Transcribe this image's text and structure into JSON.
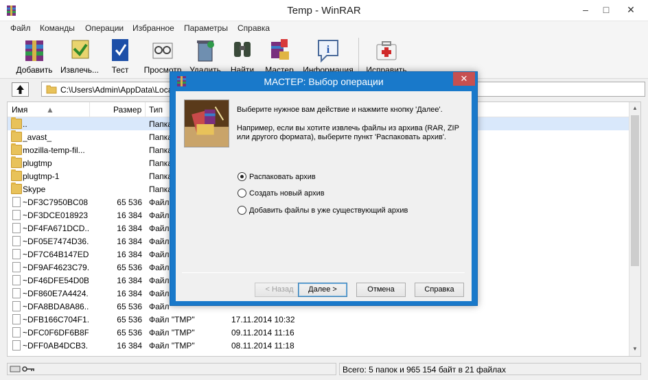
{
  "window": {
    "title": "Temp - WinRAR",
    "min_glyph": "–",
    "max_glyph": "□",
    "close_glyph": "✕"
  },
  "menu": [
    "Файл",
    "Команды",
    "Операции",
    "Избранное",
    "Параметры",
    "Справка"
  ],
  "toolbar": [
    {
      "label": "Добавить",
      "icon": "add-archive-icon"
    },
    {
      "label": "Извлечь...",
      "icon": "extract-icon"
    },
    {
      "label": "Тест",
      "icon": "test-icon"
    },
    {
      "label": "Просмотр",
      "icon": "view-icon"
    },
    {
      "label": "Удалить",
      "icon": "delete-icon"
    },
    {
      "label": "Найти",
      "icon": "find-icon"
    },
    {
      "label": "Мастер",
      "icon": "wizard-icon"
    },
    {
      "label": "Информация",
      "icon": "info-icon"
    },
    {
      "label": "Исправить",
      "icon": "repair-icon"
    }
  ],
  "address": {
    "path": "C:\\Users\\Admin\\AppData\\Local\\Temp"
  },
  "columns": {
    "name": "Имя",
    "size": "Размер",
    "type": "Тип"
  },
  "files": [
    {
      "name": "..",
      "size": "",
      "type": "Папка",
      "date": "",
      "kind": "folder",
      "selected": true
    },
    {
      "name": "_avast_",
      "size": "",
      "type": "Папка",
      "date": "",
      "kind": "folder"
    },
    {
      "name": "mozilla-temp-fil...",
      "size": "",
      "type": "Папка",
      "date": "",
      "kind": "folder"
    },
    {
      "name": "plugtmp",
      "size": "",
      "type": "Папка",
      "date": "",
      "kind": "folder"
    },
    {
      "name": "plugtmp-1",
      "size": "",
      "type": "Папка",
      "date": "",
      "kind": "folder"
    },
    {
      "name": "Skype",
      "size": "",
      "type": "Папка",
      "date": "",
      "kind": "folder"
    },
    {
      "name": "~DF3C7950BC08...",
      "size": "65 536",
      "type": "Файл",
      "date": "",
      "kind": "file"
    },
    {
      "name": "~DF3DCE018923...",
      "size": "16 384",
      "type": "Файл",
      "date": "",
      "kind": "file"
    },
    {
      "name": "~DF4FA671DCD...",
      "size": "16 384",
      "type": "Файл",
      "date": "",
      "kind": "file"
    },
    {
      "name": "~DF05E7474D36...",
      "size": "16 384",
      "type": "Файл",
      "date": "",
      "kind": "file"
    },
    {
      "name": "~DF7C64B147ED...",
      "size": "16 384",
      "type": "Файл",
      "date": "",
      "kind": "file"
    },
    {
      "name": "~DF9AF4623C79...",
      "size": "65 536",
      "type": "Файл",
      "date": "",
      "kind": "file"
    },
    {
      "name": "~DF46DFE54D0B...",
      "size": "16 384",
      "type": "Файл",
      "date": "",
      "kind": "file"
    },
    {
      "name": "~DF860E7A4424...",
      "size": "16 384",
      "type": "Файл",
      "date": "",
      "kind": "file"
    },
    {
      "name": "~DFA8BDA8A86...",
      "size": "65 536",
      "type": "Файл",
      "date": "",
      "kind": "file"
    },
    {
      "name": "~DFB166C704F1...",
      "size": "65 536",
      "type": "Файл \"TMP\"",
      "date": "17.11.2014 10:32",
      "kind": "file"
    },
    {
      "name": "~DFC0F6DF6B8F...",
      "size": "65 536",
      "type": "Файл \"TMP\"",
      "date": "09.11.2014 11:16",
      "kind": "file"
    },
    {
      "name": "~DFF0AB4DCB3...",
      "size": "16 384",
      "type": "Файл \"TMP\"",
      "date": "08.11.2014 11:18",
      "kind": "file"
    }
  ],
  "status": {
    "text": "Всего: 5 папок и 965 154 байт в 21 файлах"
  },
  "dialog": {
    "title": "МАСТЕР:   Выбор операции",
    "close_glyph": "✕",
    "intro": "Выберите нужное вам действие и нажмите кнопку 'Далее'.",
    "hint": "Например, если вы хотите извлечь файлы из архива (RAR, ZIP или другого формата), выберите пункт 'Распаковать архив'.",
    "options": [
      {
        "label": "Распаковать архив",
        "checked": true
      },
      {
        "label": "Создать новый архив",
        "checked": false
      },
      {
        "label": "Добавить файлы в уже существующий архив",
        "checked": false
      }
    ],
    "buttons": {
      "back": "< Назад",
      "next": "Далее >",
      "cancel": "Отмена",
      "help": "Справка"
    }
  }
}
